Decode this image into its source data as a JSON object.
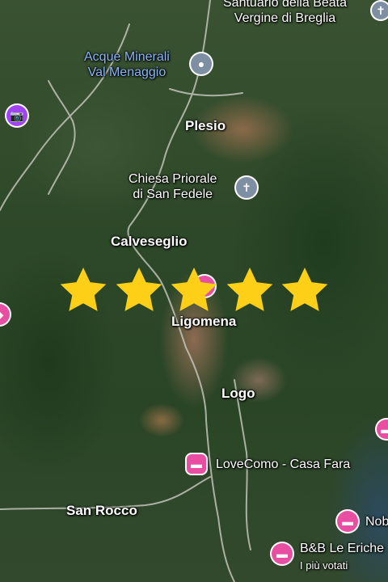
{
  "places": {
    "santuario": "Santuario della Beata\nVergine di Breglia",
    "acque": "Acque Minerali\nVal Menaggio",
    "plesio": "Plesio",
    "chiesa": "Chiesa Priorale\ndi San Fedele",
    "calveseglio": "Calveseglio",
    "ligomena": "Ligomena",
    "logo": "Logo",
    "lovecomo": "LoveComo - Casa Fara",
    "sanrocco": "San Rocco",
    "nob": "Nob",
    "bb": "B&B Le Eriche",
    "bb_sub": "I più votati"
  },
  "rating": {
    "value": 5,
    "max": 5
  },
  "colors": {
    "star": "#fdd017",
    "hotel_pin": "#e84fa3",
    "landmark_pin": "#7e8fa3",
    "camera_pin": "#a142f4",
    "transit_label": "#8ab4f8"
  },
  "icons": {
    "hotel": "bed-icon",
    "church": "cross-icon",
    "landmark": "place-icon",
    "camera": "camera-icon"
  }
}
